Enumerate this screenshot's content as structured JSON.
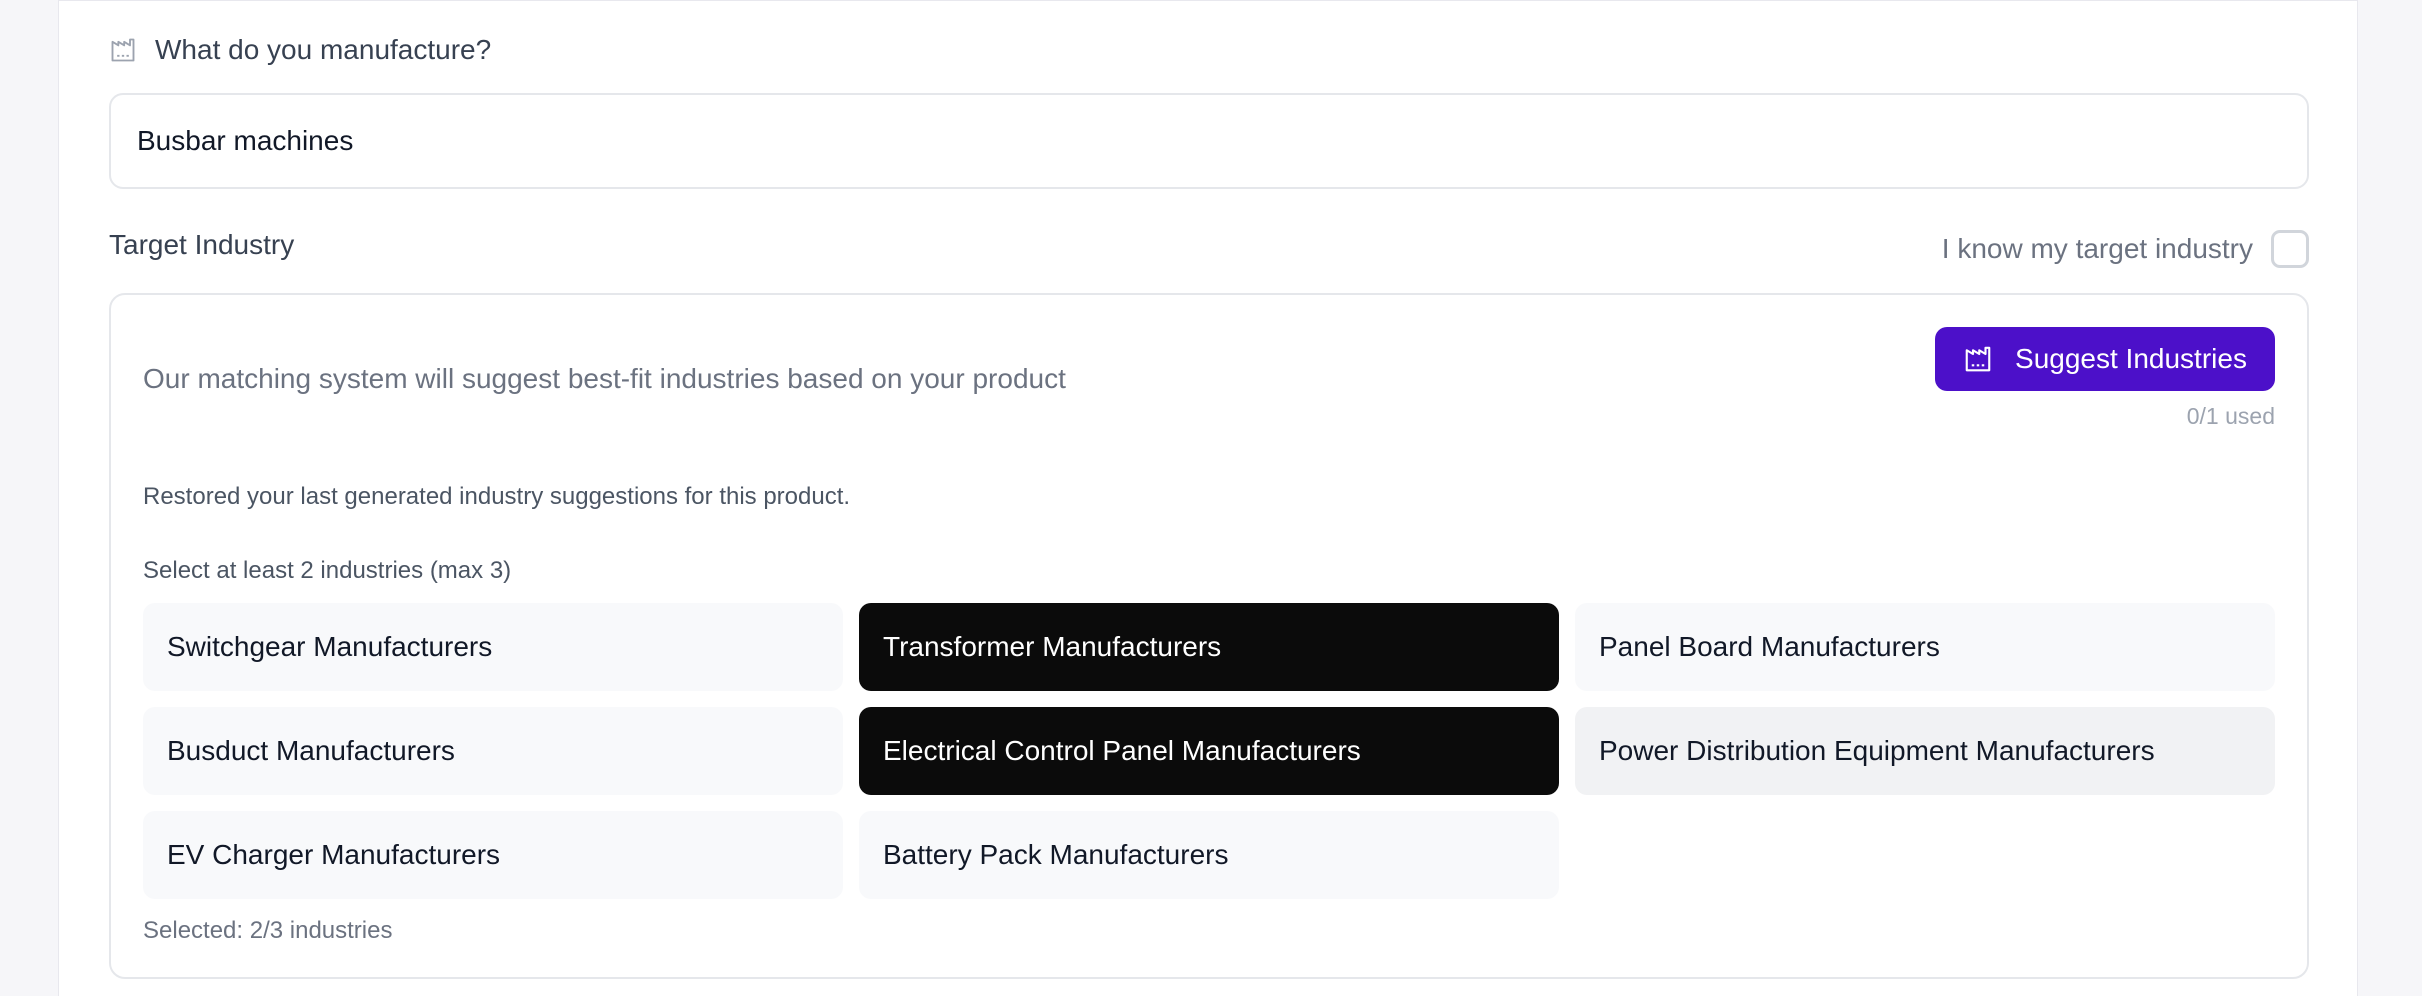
{
  "manufacture": {
    "question": "What do you manufacture?",
    "value": "Busbar machines"
  },
  "target_industry": {
    "label": "Target Industry",
    "know_label": "I know my target industry",
    "know_checked": false
  },
  "suggestions": {
    "description": "Our matching system will suggest best-fit industries based on your product",
    "button_label": "Suggest Industries",
    "usage": "0/1 used",
    "restored_note": "Restored your last generated industry suggestions for this product.",
    "select_hint": "Select at least 2 industries (max 3)",
    "industries": [
      {
        "label": "Switchgear Manufacturers",
        "selected": false
      },
      {
        "label": "Transformer Manufacturers",
        "selected": true
      },
      {
        "label": "Panel Board Manufacturers",
        "selected": false
      },
      {
        "label": "Busduct Manufacturers",
        "selected": false
      },
      {
        "label": "Electrical Control Panel Manufacturers",
        "selected": true
      },
      {
        "label": "Power Distribution Equipment Manufacturers",
        "selected": false
      },
      {
        "label": "EV Charger Manufacturers",
        "selected": false
      },
      {
        "label": "Battery Pack Manufacturers",
        "selected": false
      }
    ],
    "selected_count": "Selected: 2/3 industries"
  },
  "colors": {
    "accent": "#4c10c9",
    "selected_chip": "#0b0b0b"
  }
}
